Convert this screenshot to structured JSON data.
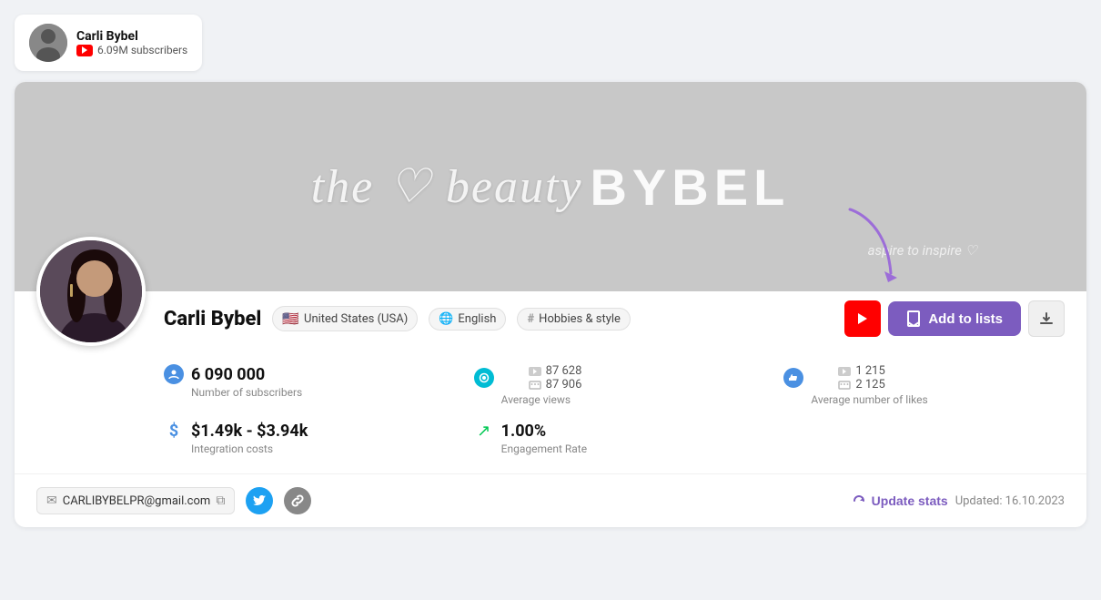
{
  "mini_card": {
    "name": "Carli Bybel",
    "subscribers": "6.09M subscribers"
  },
  "profile": {
    "name": "Carli Bybel",
    "country": "United States (USA)",
    "language": "English",
    "category": "Hobbies & style",
    "banner_text": "the beauty",
    "banner_bybel": "BYBEL",
    "banner_tagline": "aspire to inspire ♡"
  },
  "stats": {
    "subscribers": {
      "value": "6 090 000",
      "label": "Number of subscribers"
    },
    "views": {
      "yt_value": "87 628",
      "sub_value": "87 906",
      "label": "Average views"
    },
    "likes": {
      "yt_value": "1 215",
      "sub_value": "2 125",
      "label": "Average number of likes"
    },
    "integration_costs": {
      "value": "$1.49k - $3.94k",
      "label": "Integration costs"
    },
    "engagement_rate": {
      "value": "1.00%",
      "label": "Engagement Rate"
    }
  },
  "footer": {
    "email": "CARLIBYBELPR@gmail.com",
    "update_button": "Update stats",
    "updated_label": "Updated: 16.10.2023"
  },
  "buttons": {
    "add_to_lists": "Add to lists"
  }
}
